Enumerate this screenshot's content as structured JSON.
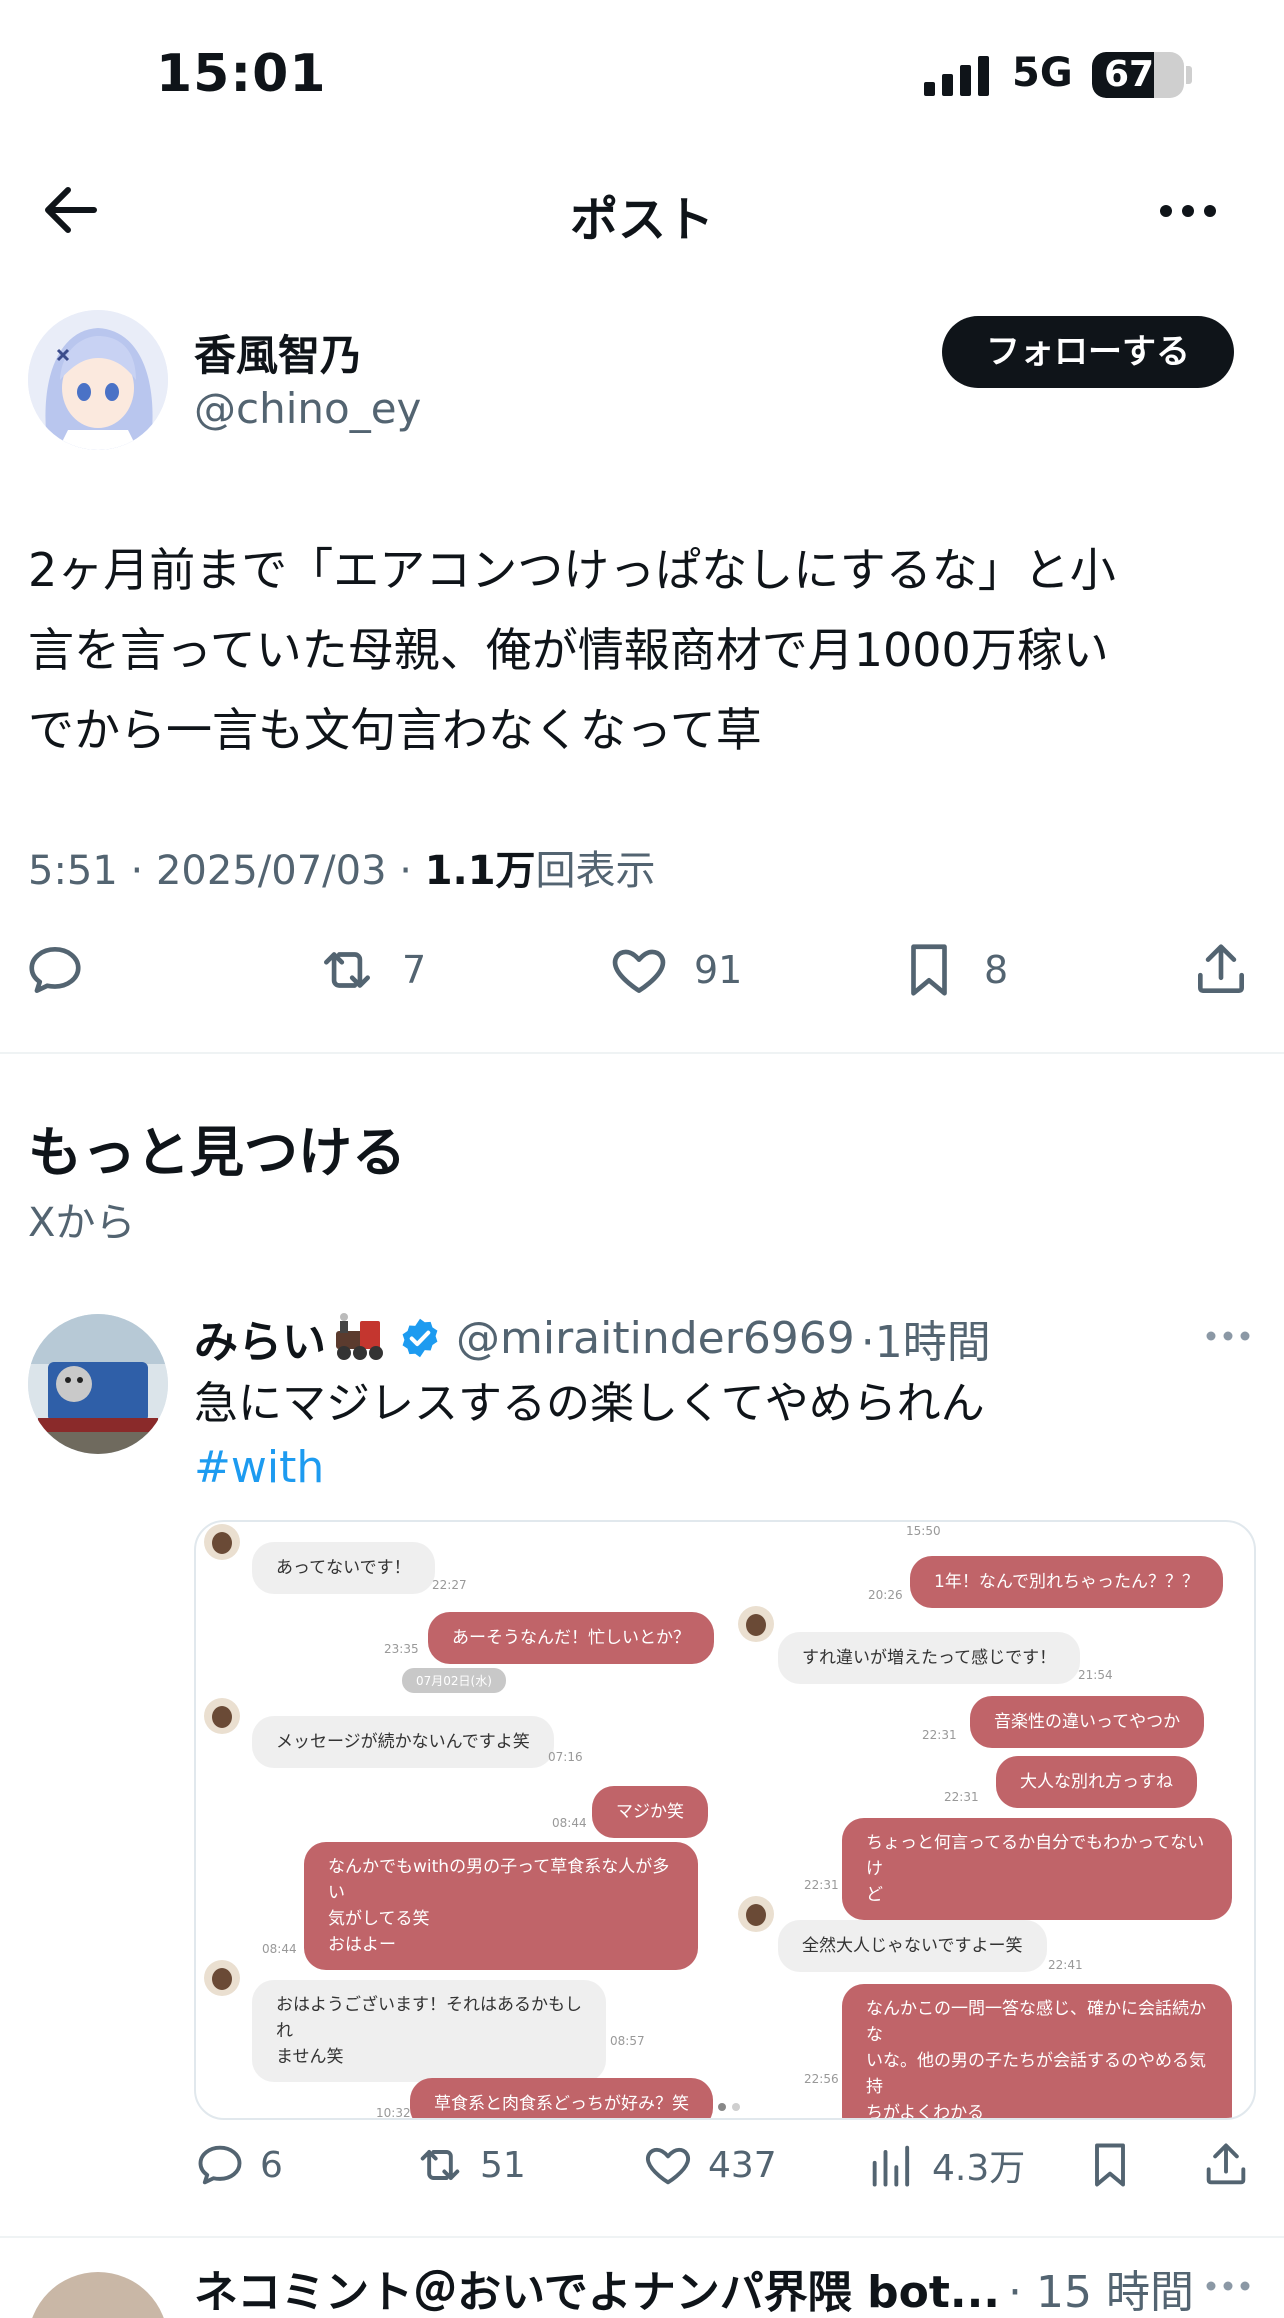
{
  "status_bar": {
    "time": "15:01",
    "network": "5G",
    "battery": "67",
    "battery_level": 0.67
  },
  "nav": {
    "title": "ポスト"
  },
  "post": {
    "author_name": "香風智乃",
    "author_handle": "@chino_ey",
    "follow_label": "フォローする",
    "text_lines": [
      "2ヶ月前まで「エアコンつけっぱなしにするな」と小",
      "言を言っていた母親、俺が情報商材で月1000万稼い",
      "でから一言も文句言わなくなって草"
    ],
    "time": "5:51",
    "date": "2025/07/03",
    "views": "1.1万",
    "views_label": "回表示",
    "retweets": "7",
    "likes": "91",
    "bookmarks": "8"
  },
  "discover": {
    "title": "もっと見つける",
    "subtitle": "Xから"
  },
  "tweet2": {
    "name": "みらい",
    "handle": "@miraitinder6969",
    "time": "·1時間",
    "text": "急にマジレスするの楽しくてやめられん",
    "hashtag": "#with",
    "replies": "6",
    "retweets": "51",
    "likes": "437",
    "views": "4.3万",
    "chat_left": [
      {
        "text": "あってないです！",
        "dir": "in",
        "time": "22:27"
      },
      {
        "text": "あーそうなんだ！忙しいとか？",
        "dir": "out",
        "time": "23:35"
      },
      {
        "text": "07月02日(水)",
        "dir": "date",
        "time": ""
      },
      {
        "text": "メッセージが続かないんですよ笑",
        "dir": "in",
        "time": "07:16"
      },
      {
        "text": "マジか笑",
        "dir": "out",
        "time": "08:44"
      },
      {
        "text": "なんかでもwithの男の子って草食系な人が多い",
        "dir": "out",
        "time": ""
      },
      {
        "text": "気がしてる笑",
        "dir": "out",
        "time": ""
      },
      {
        "text": "おはよー",
        "dir": "out",
        "time": "08:44"
      },
      {
        "text": "おはようございます！それはあるかもしれ",
        "dir": "in",
        "time": ""
      },
      {
        "text": "ません笑",
        "dir": "in",
        "time": "08:57"
      },
      {
        "text": "草食系と肉食系どっちが好み？笑",
        "dir": "out",
        "time": "10:32"
      }
    ],
    "chat_right": [
      {
        "text": "15:50",
        "dir": "ts",
        "time": ""
      },
      {
        "text": "1年！なんで別れちゃったん？？？",
        "dir": "out",
        "time": "20:26"
      },
      {
        "text": "すれ違いが増えたって感じです！",
        "dir": "in",
        "time": "21:54"
      },
      {
        "text": "音楽性の違いってやつか",
        "dir": "out",
        "time": "22:31"
      },
      {
        "text": "大人な別れ方っすね",
        "dir": "out",
        "time": "22:31"
      },
      {
        "text": "ちょっと何言ってるか自分でもわかってないけ",
        "dir": "out",
        "time": ""
      },
      {
        "text": "ど",
        "dir": "out",
        "time": "22:31"
      },
      {
        "text": "全然大人じゃないですよー笑",
        "dir": "in",
        "time": "22:41"
      },
      {
        "text": "なんかこの一問一答な感じ、確かに会話続かな",
        "dir": "out",
        "time": ""
      },
      {
        "text": "いな。他の男の子たちが会話するのやめる気持",
        "dir": "out",
        "time": ""
      },
      {
        "text": "ちがよくわかる",
        "dir": "out",
        "time": "22:56"
      }
    ]
  },
  "tweet3": {
    "name": "ネコミント＠おいでよナンパ界隈 bot...",
    "time": "· 15 時間"
  },
  "colors": {
    "accent": "#1d9bf0",
    "text": "#0f1419",
    "muted": "#536471",
    "chat_out": "#c06469"
  }
}
